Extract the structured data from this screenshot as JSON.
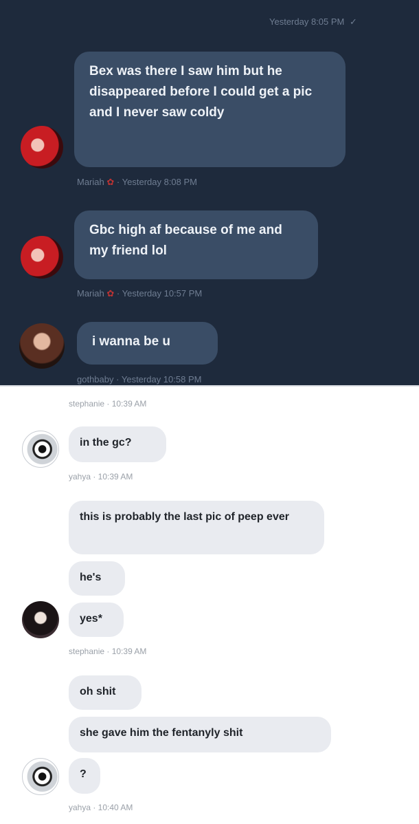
{
  "dark_chat": {
    "top_meta": "Yesterday 8:05 PM",
    "check_icon": "check-icon",
    "messages": [
      {
        "text": "Bex was there I saw him but he disappeared before I could get a pic and I never saw coldy",
        "sender": "Mariah",
        "time": "Yesterday 8:08 PM"
      },
      {
        "text": "Gbc high af because of me and my friend lol",
        "sender": "Mariah",
        "time": "Yesterday 10:57 PM"
      },
      {
        "text": "i wanna be u",
        "sender": "gothbaby",
        "time": "Yesterday 10:58 PM"
      }
    ]
  },
  "light_chat": {
    "cut_meta": "stephanie · 10:39 AM",
    "messages": [
      {
        "text": "in the gc?",
        "meta": "yahya · 10:39 AM"
      },
      {
        "text": "this is probably the last pic of peep ever"
      },
      {
        "text": "he's"
      },
      {
        "text": "yes*",
        "meta": "stephanie · 10:39 AM"
      },
      {
        "text": "oh shit"
      },
      {
        "text": "she gave him the fentanyly shit"
      },
      {
        "text": "?",
        "meta": "yahya · 10:40 AM"
      }
    ]
  },
  "colors": {
    "dark_bg": "#1e2a3c",
    "dark_bubble": "#3a4d66",
    "light_bubble": "#e9ebf0"
  }
}
